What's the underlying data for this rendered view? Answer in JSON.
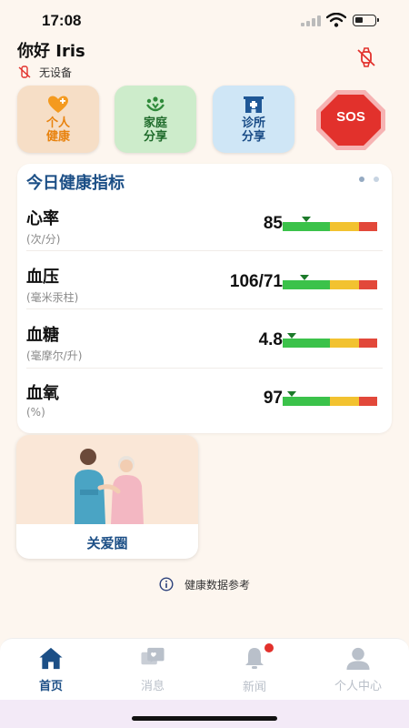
{
  "status_bar": {
    "time": "17:08"
  },
  "header": {
    "greeting": "你好 Iris",
    "device_status": "无设备"
  },
  "quick_actions": [
    {
      "label": "个人健康",
      "icon": "heart-plus-icon",
      "color": "#e8830f"
    },
    {
      "label": "家庭分享",
      "icon": "family-icon",
      "color": "#1f6b2b"
    },
    {
      "label": "诊所分享",
      "icon": "clinic-icon",
      "color": "#184b86"
    },
    {
      "label": "SOS",
      "icon": "sos-icon",
      "color": "#e2312c"
    }
  ],
  "health_card": {
    "title": "今日健康指标",
    "page_indicator": {
      "count": 2,
      "active": 1
    },
    "metrics": [
      {
        "name": "心率",
        "unit": "(次/分)",
        "value": "85",
        "level": 0.2
      },
      {
        "name": "血压",
        "unit": "(毫米汞柱)",
        "value": "106/71",
        "level": 0.18
      },
      {
        "name": "血糖",
        "unit": "(毫摩尔/升)",
        "value": "4.8",
        "level": 0.05
      },
      {
        "name": "血氧",
        "unit": "(%)",
        "value": "97",
        "level": 0.05
      }
    ]
  },
  "care_circle": {
    "label": "关爱圈"
  },
  "reference": {
    "text": "健康数据参考"
  },
  "tabbar": {
    "items": [
      {
        "label": "首页",
        "icon": "home-icon",
        "active": true
      },
      {
        "label": "消息",
        "icon": "message-icon",
        "active": false
      },
      {
        "label": "新闻",
        "icon": "bell-icon",
        "active": false
      },
      {
        "label": "个人中心",
        "icon": "person-icon",
        "active": false
      }
    ]
  },
  "colors": {
    "brand_blue": "#1c4f86",
    "background": "#fdf6ef",
    "range_green": "#3bc24a",
    "range_yellow": "#f2c230",
    "range_red": "#e2483a"
  }
}
